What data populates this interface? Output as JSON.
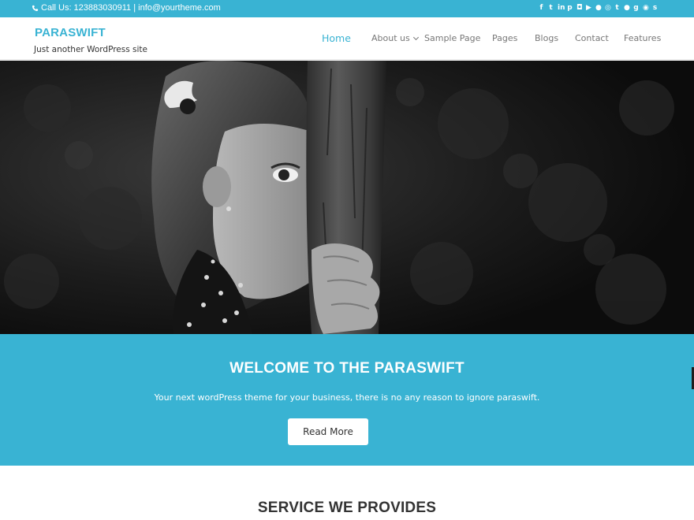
{
  "topbar": {
    "contact_text": "Call Us: 123883030911 | info@yourtheme.com",
    "social_icons": [
      "facebook-icon",
      "twitter-icon",
      "linkedin-icon",
      "pinterest-icon",
      "instagram-icon",
      "youtube-icon",
      "flickr-icon",
      "dribbble-icon",
      "tumblr-icon",
      "reddit-icon",
      "google-plus-icon",
      "github-icon",
      "stumbleupon-icon"
    ]
  },
  "header": {
    "site_title": "PARASWIFT",
    "tagline": "Just another WordPress site"
  },
  "nav": {
    "items": [
      "Home",
      "About us",
      "Sample Page",
      "Pages",
      "Blogs",
      "Contact",
      "Features"
    ],
    "active": "Home"
  },
  "banner": {
    "title": "WELCOME TO THE PARASWIFT",
    "description": "Your next wordPress theme for your business, there is no any reason to ignore paraswift.",
    "button_label": "Read More"
  },
  "sections": {
    "services_title": "SERVICE WE PROVIDES"
  },
  "colors": {
    "accent": "#39b3d3",
    "text": "#333333",
    "nav_text": "#777777"
  }
}
